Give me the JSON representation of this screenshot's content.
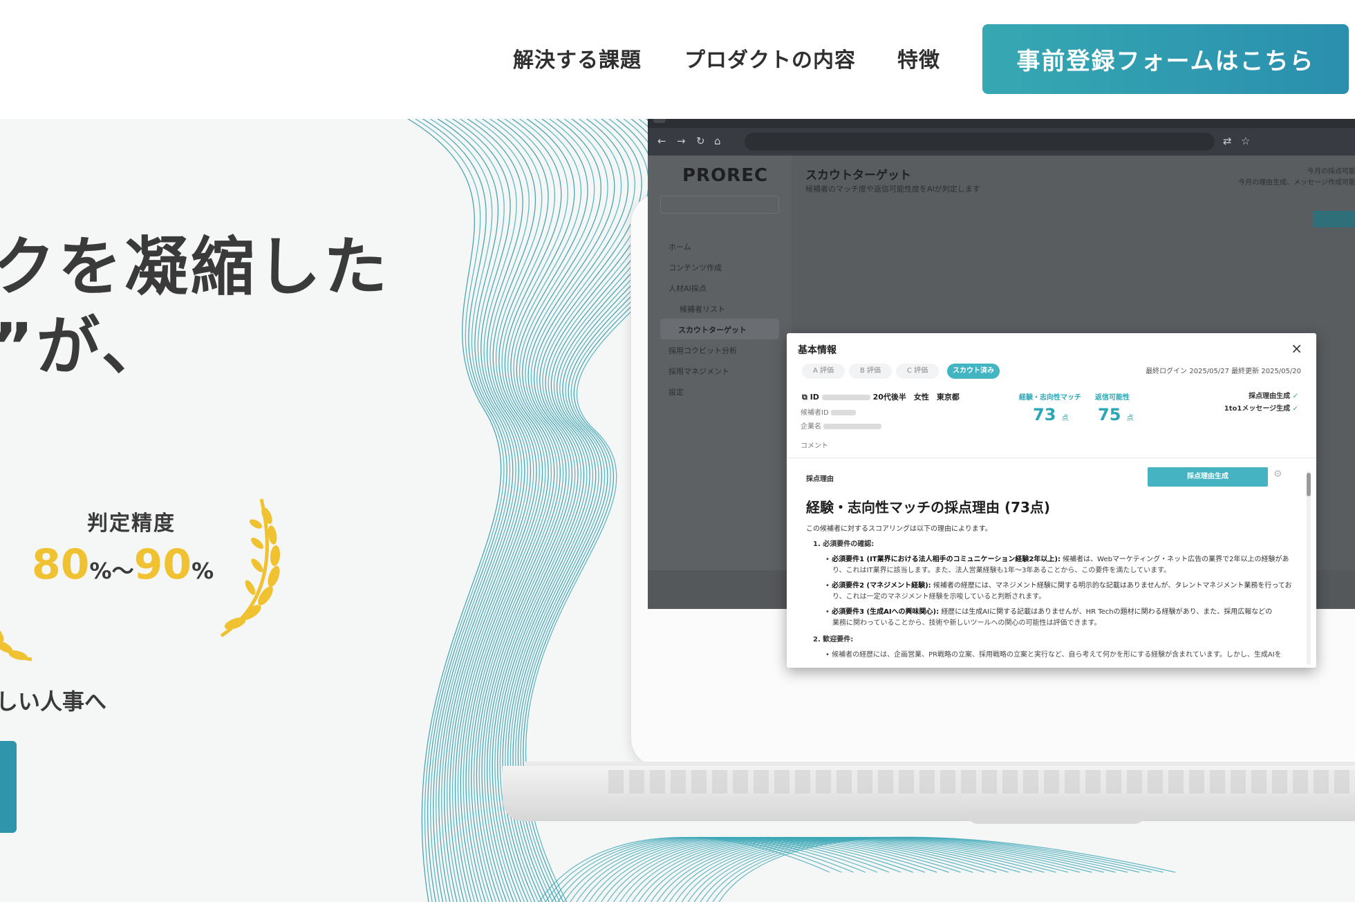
{
  "nav": {
    "items": [
      "解決する課題",
      "プロダクトの内容",
      "特徴"
    ],
    "cta": "事前登録フォームはこちら"
  },
  "hero": {
    "line1": "クを凝縮した",
    "line2": "”が、",
    "accuracy_label": "判定精度",
    "accuracy_from": "80",
    "accuracy_to": "90",
    "percent": "%",
    "tilde": "～",
    "sub": "しい人事へ"
  },
  "app": {
    "logo": "PROREC",
    "sidebar": [
      "ホーム",
      "コンテンツ作成",
      "人材AI採点",
      "候補者リスト",
      "スカウトターゲット",
      "採用コクピット分析",
      "採用マネジメント",
      "設定"
    ],
    "page_title": "スカウトターゲット",
    "page_subtitle": "候補者のマッチ度や返信可能性度をAIが判定します",
    "right_note_1": "今月の採点可能",
    "right_note_2": "今月の理由生成、メッセージ作成可能",
    "modal": {
      "title": "基本情報",
      "close": "×",
      "chips": [
        "A 評価",
        "B 評価",
        "C 評価",
        "スカウト済み"
      ],
      "meta": "最終ログイン 2025/05/27   最終更新 2025/05/20",
      "id_label": "ID",
      "profile": "20代後半　女性　東京都",
      "candidate_id_label": "候補者ID",
      "company_label": "企業名",
      "comment_label": "コメント",
      "score1_label": "経験・志向性マッチ",
      "score1": "73",
      "score2_label": "返信可能性",
      "score2": "75",
      "score_unit": "点",
      "check1": "採点理由生成",
      "check2": "1to1メッセージ生成",
      "check_mark": "✓",
      "section": "採点理由",
      "generate_btn": "採点理由生成",
      "heading": "経験・志向性マッチの採点理由 (73点)",
      "intro": "この候補者に対するスコアリングは以下の理由によります。",
      "list_title_1": "1. 必須要件の確認:",
      "req1_bold": "必須要件1 (IT業界における法人相手のコミュニケーション経験2年以上):",
      "req1_text": "候補者は、Webマーケティング・ネット広告の業界で2年以上の経験があ",
      "req1_text2": "り、これはIT業界に該当します。また、法人営業経験も1年～3年あることから、この要件を満たしています。",
      "req2_bold": "必須要件2 (マネジメント経験):",
      "req2_text": "候補者の経歴には、マネジメント経験に関する明示的な記載はありませんが、タレントマネジメント業務を行ってお",
      "req2_text2": "り、これは一定のマネジメント経験を示唆していると判断されます。",
      "req3_bold": "必須要件3 (生成AIへの興味関心):",
      "req3_text": "経歴には生成AIに関する記載はありませんが、HR Techの題材に関わる経験があり、また、採用広報などの",
      "req3_text2": "業務に関わっていることから、技術や新しいツールへの関心の可能性は評価できます。",
      "list_title_2": "2. 歓迎要件:",
      "welcome_text": "候補者の経歴には、企画営業、PR戦略の立案、採用戦略の立案と実行など、自ら考えて何かを形にする経験が含まれています。しかし、生成AIを"
    }
  },
  "colors": {
    "teal": "#36a8b2",
    "gold": "#f0c232",
    "text": "#333333"
  }
}
